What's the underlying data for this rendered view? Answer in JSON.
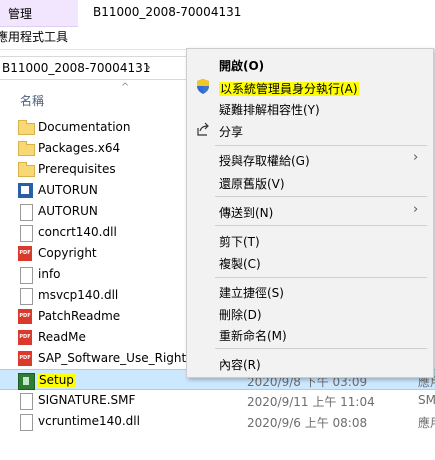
{
  "ribbon": {
    "manage_tab": "管理",
    "app_tools": "應用程式工具",
    "window_title": "B11000_2008-70004131"
  },
  "address": {
    "path": "B11000_2008-70004131",
    "chevron": "›"
  },
  "columns": {
    "name": "名稱"
  },
  "files": [
    {
      "name": "Documentation",
      "icon": "folder-icon",
      "date": "",
      "type": ""
    },
    {
      "name": "Packages.x64",
      "icon": "folder-icon",
      "date": "",
      "type": ""
    },
    {
      "name": "Prerequisites",
      "icon": "folder-icon",
      "date": "",
      "type": ""
    },
    {
      "name": "AUTORUN",
      "icon": "autorun-app-icon",
      "date": "",
      "type": ""
    },
    {
      "name": "AUTORUN",
      "icon": "settings-file-icon",
      "date": "",
      "type": ""
    },
    {
      "name": "concrt140.dll",
      "icon": "dll-icon",
      "date": "",
      "type": ""
    },
    {
      "name": "Copyright",
      "icon": "pdf-icon",
      "date": "",
      "type": ""
    },
    {
      "name": "info",
      "icon": "text-file-icon",
      "date": "",
      "type": ""
    },
    {
      "name": "msvcp140.dll",
      "icon": "dll-icon",
      "date": "",
      "type": ""
    },
    {
      "name": "PatchReadme",
      "icon": "pdf-icon",
      "date": "",
      "type": ""
    },
    {
      "name": "ReadMe",
      "icon": "pdf-icon",
      "date": "",
      "type": ""
    },
    {
      "name": "SAP_Software_Use_Rights",
      "icon": "pdf-icon",
      "date": "",
      "type": ""
    },
    {
      "name": "Setup",
      "icon": "setup-icon",
      "date": "2020/9/8 下午 03:09",
      "type": "應用"
    },
    {
      "name": "SIGNATURE.SMF",
      "icon": "smf-file-icon",
      "date": "2020/9/11 上午 11:04",
      "type": "SM"
    },
    {
      "name": "vcruntime140.dll",
      "icon": "dll-icon",
      "date": "2020/9/6 上午 08:08",
      "type": "應用"
    }
  ],
  "menu": {
    "open": "開啟(O)",
    "run_as_admin": "以系統管理員身分執行(A)",
    "troubleshoot": "疑難排解相容性(Y)",
    "share": "分享",
    "give_access": "授與存取權給(G)",
    "restore_versions": "還原舊版(V)",
    "send_to": "傳送到(N)",
    "cut": "剪下(T)",
    "copy": "複製(C)",
    "create_shortcut": "建立捷徑(S)",
    "delete": "刪除(D)",
    "rename": "重新命名(M)",
    "properties": "內容(R)",
    "submenu_arrow": "›"
  },
  "colors": {
    "highlight": "#ffff00",
    "selection": "#cce8ff",
    "manage_tab": "#f2e6ff"
  }
}
